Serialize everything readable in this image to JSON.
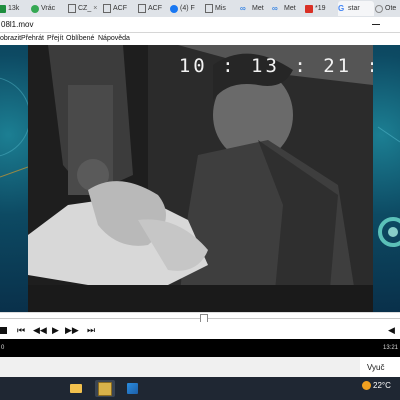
{
  "browser": {
    "tabs": [
      {
        "label": "13k",
        "icon": "google-sheets-icon"
      },
      {
        "label": "Vrác",
        "icon": "check-leaf-icon"
      },
      {
        "label": "CZ_",
        "icon": "document-icon"
      },
      {
        "label": "ACF",
        "icon": "document-icon"
      },
      {
        "label": "ACF",
        "icon": "document-icon"
      },
      {
        "label": "(4) F",
        "icon": "facebook-icon"
      },
      {
        "label": "Mis",
        "icon": "document-icon"
      },
      {
        "label": "Met",
        "icon": "meta-icon"
      },
      {
        "label": "Met",
        "icon": "meta-icon"
      },
      {
        "label": "*19",
        "icon": "pdf-icon"
      },
      {
        "label": "star",
        "icon": "google-icon"
      },
      {
        "label": "Ote",
        "icon": "globe-icon"
      }
    ],
    "close_glyph": "×"
  },
  "player": {
    "title": "08l1.mov",
    "menu": [
      "obrazit",
      "Přehrát",
      "Přejít",
      "Oblíbené",
      "Nápověda"
    ],
    "overlay_timecode": "10 : 13 : 21 :",
    "seek_fraction": 0.51,
    "status_left": "0",
    "status_time": "13:21"
  },
  "notification": {
    "text": "Vyuč"
  },
  "taskbar": {
    "weather_temp": "22°C",
    "icons": [
      "file-explorer-icon",
      "media-player-icon",
      "photos-icon"
    ]
  },
  "colors": {
    "taskbar": "#1f2733",
    "wallpaper": "#0d4a63",
    "accent_weather": "#f0a020"
  }
}
